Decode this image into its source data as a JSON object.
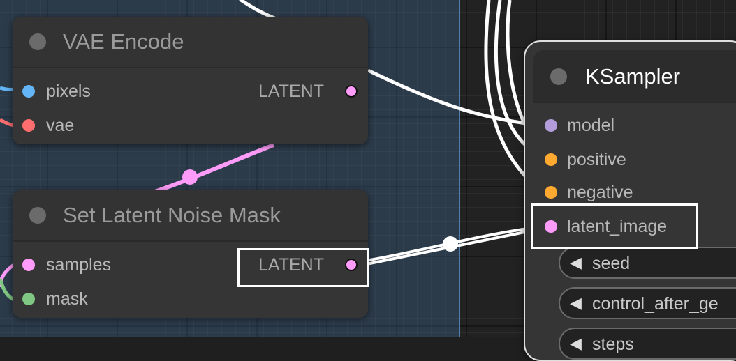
{
  "canvas": {
    "group_color": "#3c648c",
    "link_color": "#ffffff",
    "latent_link_color": "#ff9cf9"
  },
  "colors": {
    "image": "#64b5f6",
    "vae": "#ff6e6e",
    "latent": "#ff9cf9",
    "mask": "#81c784",
    "model": "#b39ddb",
    "conditioning": "#ffa931"
  },
  "nodes": {
    "vae_encode": {
      "title": "VAE Encode",
      "inputs": [
        {
          "label": "pixels",
          "type": "IMAGE"
        },
        {
          "label": "vae",
          "type": "VAE"
        }
      ],
      "output": {
        "label": "LATENT"
      }
    },
    "set_latent_noise_mask": {
      "title": "Set Latent Noise Mask",
      "inputs": [
        {
          "label": "samples",
          "type": "LATENT"
        },
        {
          "label": "mask",
          "type": "MASK"
        }
      ],
      "output": {
        "label": "LATENT"
      }
    },
    "ksampler": {
      "title": "KSampler",
      "inputs": [
        {
          "label": "model",
          "type": "MODEL"
        },
        {
          "label": "positive",
          "type": "CONDITIONING"
        },
        {
          "label": "negative",
          "type": "CONDITIONING"
        },
        {
          "label": "latent_image",
          "type": "LATENT"
        }
      ],
      "widgets": [
        {
          "label": "seed",
          "icon": "left-arrow-icon"
        },
        {
          "label": "control_after_ge",
          "icon": "left-arrow-icon"
        },
        {
          "label": "steps",
          "icon": "left-arrow-icon"
        }
      ]
    }
  }
}
